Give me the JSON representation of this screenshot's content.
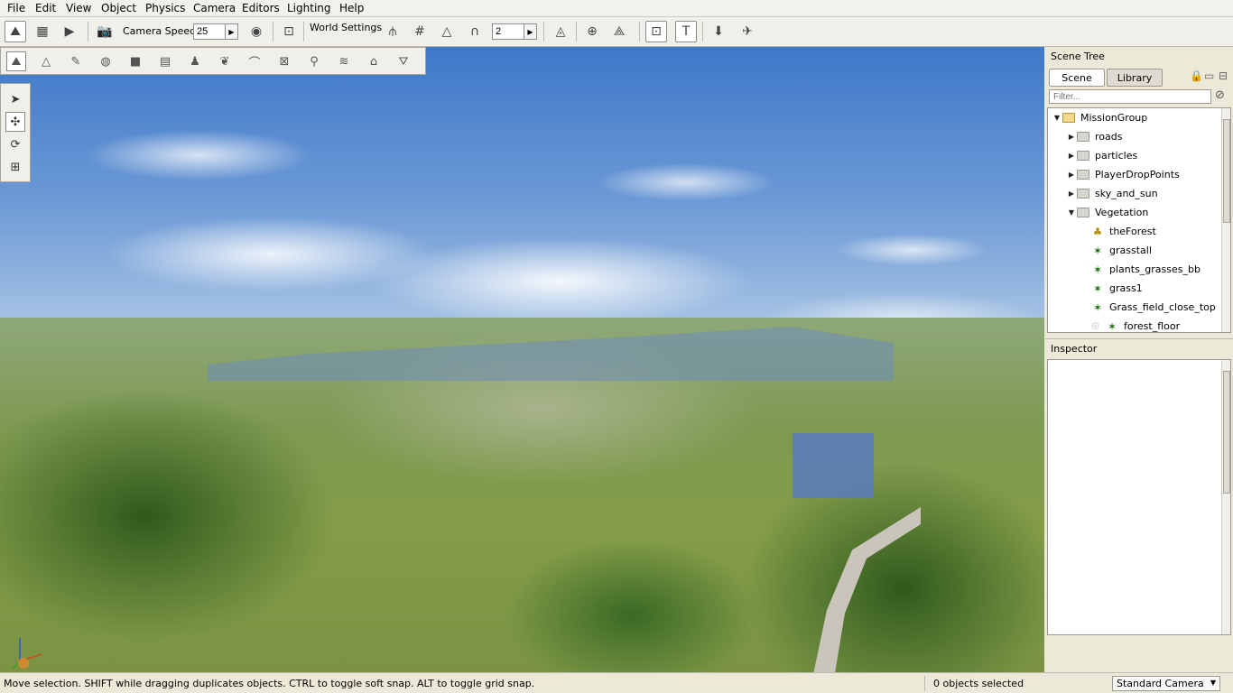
{
  "menu": [
    "File",
    "Edit",
    "View",
    "Object",
    "Physics",
    "Camera",
    "Editors",
    "Lighting",
    "Help"
  ],
  "toolbar": {
    "camera_speed_label": "Camera Speed",
    "camera_speed_value": "25",
    "world_settings_label": "World Settings",
    "snap_value": "2"
  },
  "scene_tree": {
    "title": "Scene Tree",
    "tabs": {
      "scene": "Scene",
      "library": "Library"
    },
    "filter_placeholder": "Filter...",
    "items": [
      {
        "label": "MissionGroup",
        "kind": "folder-open",
        "expanded": true
      },
      {
        "label": "roads",
        "kind": "folder",
        "expanded": false
      },
      {
        "label": "particles",
        "kind": "folder",
        "expanded": false
      },
      {
        "label": "PlayerDropPoints",
        "kind": "folder",
        "expanded": false
      },
      {
        "label": "sky_and_sun",
        "kind": "folder",
        "expanded": false
      },
      {
        "label": "Vegetation",
        "kind": "folder",
        "expanded": true
      },
      {
        "label": "theForest",
        "kind": "forest"
      },
      {
        "label": "grasstall",
        "kind": "grass"
      },
      {
        "label": "plants_grasses_bb",
        "kind": "grass"
      },
      {
        "label": "grass1",
        "kind": "grass"
      },
      {
        "label": "Grass_field_close_top",
        "kind": "grass"
      },
      {
        "label": "forest_floor",
        "kind": "grass-hidden"
      }
    ]
  },
  "inspector": {
    "title": "Inspector"
  },
  "status": {
    "hint": "Move selection.  SHIFT while dragging duplicates objects.  CTRL to toggle soft snap.  ALT to toggle grid snap.",
    "selection": "0 objects selected",
    "camera_mode": "Standard Camera"
  },
  "colors": {
    "sky_top": "#3e78c8",
    "terrain": "#7e9a52",
    "placeholder_blue": "#5a7db8",
    "panel_bg": "#ece9d8"
  }
}
